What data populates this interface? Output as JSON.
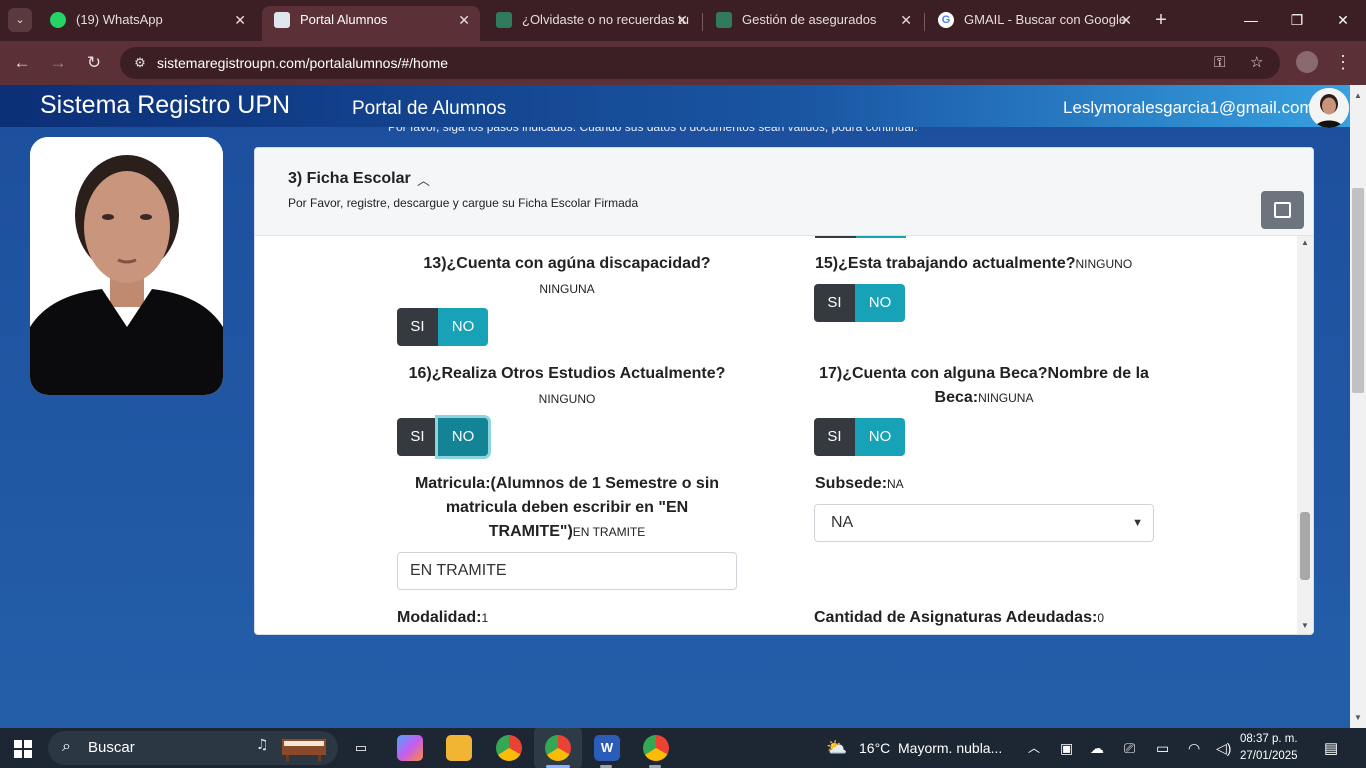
{
  "browser": {
    "tabs": [
      {
        "title": "(19) WhatsApp",
        "badge": "19"
      },
      {
        "title": "Portal Alumnos"
      },
      {
        "title": "¿Olvidaste o no recuerdas tu"
      },
      {
        "title": "Gestión de asegurados"
      },
      {
        "title": "GMAIL - Buscar con Google"
      }
    ],
    "url": "sistemaregistroupn.com/portalalumnos/#/home"
  },
  "site": {
    "brand": "Sistema Registro UPN",
    "portal_title": "Portal de Alumnos",
    "user_email": "Leslymoralesgarcia1@gmail.com",
    "notice": "Por favor, siga los pasos indicados. Cuando sus datos o documentos sean válidos, podrá continuar."
  },
  "panel": {
    "title": "3) Ficha Escolar",
    "subtitle": "Por Favor, registre, descargue y cargue su Ficha Escolar Firmada"
  },
  "form": {
    "si_label": "SI",
    "no_label": "NO",
    "q13": {
      "label": "13)¿Cuenta con agúna discapacidad?",
      "answer": "NINGUNA"
    },
    "q15": {
      "label": "15)¿Esta trabajando actualmente?",
      "answer": "NINGUNO"
    },
    "q16": {
      "label": "16)¿Realiza Otros Estudios Actualmente?",
      "answer": "NINGUNO"
    },
    "q17": {
      "label_line1": "17)¿Cuenta con alguna Beca?Nombre de la",
      "label_line2": "Beca:",
      "answer": "NINGUNA"
    },
    "matricula": {
      "label_line1": "Matricula:(Alumnos de 1 Semestre o sin",
      "label_line2": "matricula deben escribir en \"EN",
      "label_line3": "TRAMITE\")",
      "answer": "EN TRAMITE",
      "input_value": "EN TRAMITE"
    },
    "subsede": {
      "label": "Subsede:",
      "answer": "NA",
      "selected": "NA"
    },
    "modalidad": {
      "label": "Modalidad:",
      "answer": "1"
    },
    "asignaturas": {
      "label": "Cantidad de Asignaturas Adeudadas:",
      "answer": "0"
    }
  },
  "taskbar": {
    "search_label": "Buscar",
    "weather_temp": "16°C",
    "weather_text": "Mayorm. nubla...",
    "time": "08:37 p. m.",
    "date": "27/01/2025"
  }
}
